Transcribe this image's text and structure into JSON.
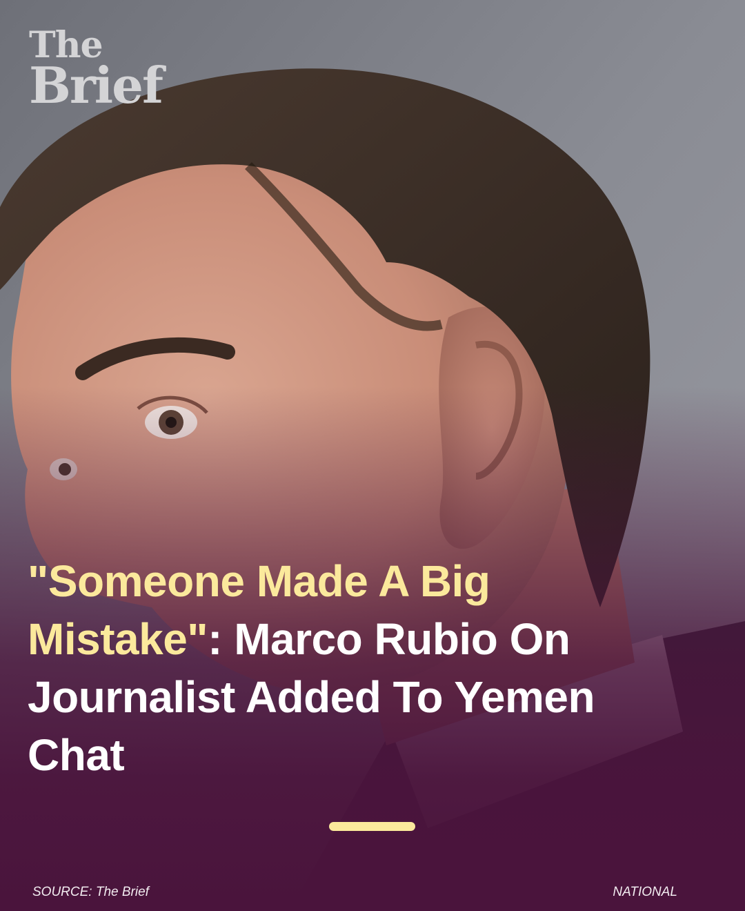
{
  "brand": {
    "logo_line1": "The",
    "logo_line2": "Brief"
  },
  "headline": {
    "quote": "\"Someone Made A Big Mistake\"",
    "rest": ": Marco Rubio On Journalist Added To Yemen Chat",
    "quote_color": "#fbe99c",
    "text_color": "#ffffff"
  },
  "photo": {
    "subject": "close-up profile portrait of a man"
  },
  "footer": {
    "source": "SOURCE: The Brief",
    "category": "NATIONAL"
  },
  "colors": {
    "accent": "#fbe99c",
    "overlay": "#4a143c"
  }
}
